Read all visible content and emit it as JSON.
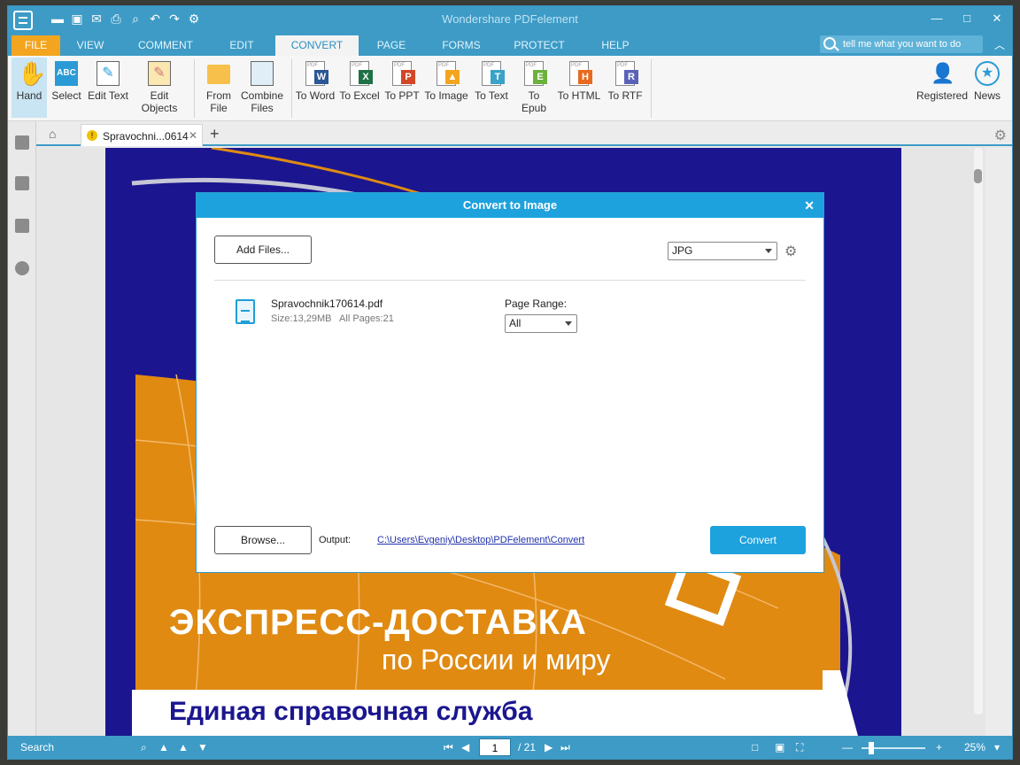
{
  "app": {
    "title": "Wondershare PDFelement"
  },
  "menu_tabs": [
    "FILE",
    "VIEW",
    "COMMENT",
    "EDIT",
    "CONVERT",
    "PAGE",
    "FORMS",
    "PROTECT",
    "HELP"
  ],
  "search": {
    "placeholder": "tell me what you want to do"
  },
  "ribbon": {
    "hand": "Hand",
    "select": "Select",
    "edit_text": "Edit Text",
    "edit_objects": "Edit Objects",
    "from_file": "From File",
    "combine_files": "Combine Files",
    "to_word": "To Word",
    "to_excel": "To Excel",
    "to_ppt": "To PPT",
    "to_image": "To Image",
    "to_text": "To Text",
    "to_epub": "To Epub",
    "to_html": "To HTML",
    "to_rtf": "To RTF",
    "registered": "Registered",
    "news": "News"
  },
  "document_tab": {
    "label": "Spravochni...0614"
  },
  "page_text": {
    "line1": "ЭКСПРЕСС-ДОСТАВКА",
    "line2": "по России и миру",
    "line3": "Единая справочная служба"
  },
  "dialog": {
    "title": "Convert to Image",
    "add_files": "Add Files...",
    "format": "JPG",
    "file_name": "Spravochnik170614.pdf",
    "file_size": "Size:13,29MB",
    "file_pages": "All Pages:21",
    "page_range_label": "Page Range:",
    "page_range_value": "All",
    "browse": "Browse...",
    "output_label": "Output:",
    "output_path": "C:\\Users\\Evgeniy\\Desktop\\PDFelement\\Convert",
    "convert": "Convert"
  },
  "status": {
    "search": "Search",
    "page": "1",
    "total": "/ 21",
    "zoom": "25%"
  },
  "colors": {
    "accent": "#3d9bc6",
    "file_tab": "#f3a51f",
    "page_bg": "#1b168f",
    "page_orange": "#e08a12",
    "convert_btn": "#1ea2de"
  }
}
